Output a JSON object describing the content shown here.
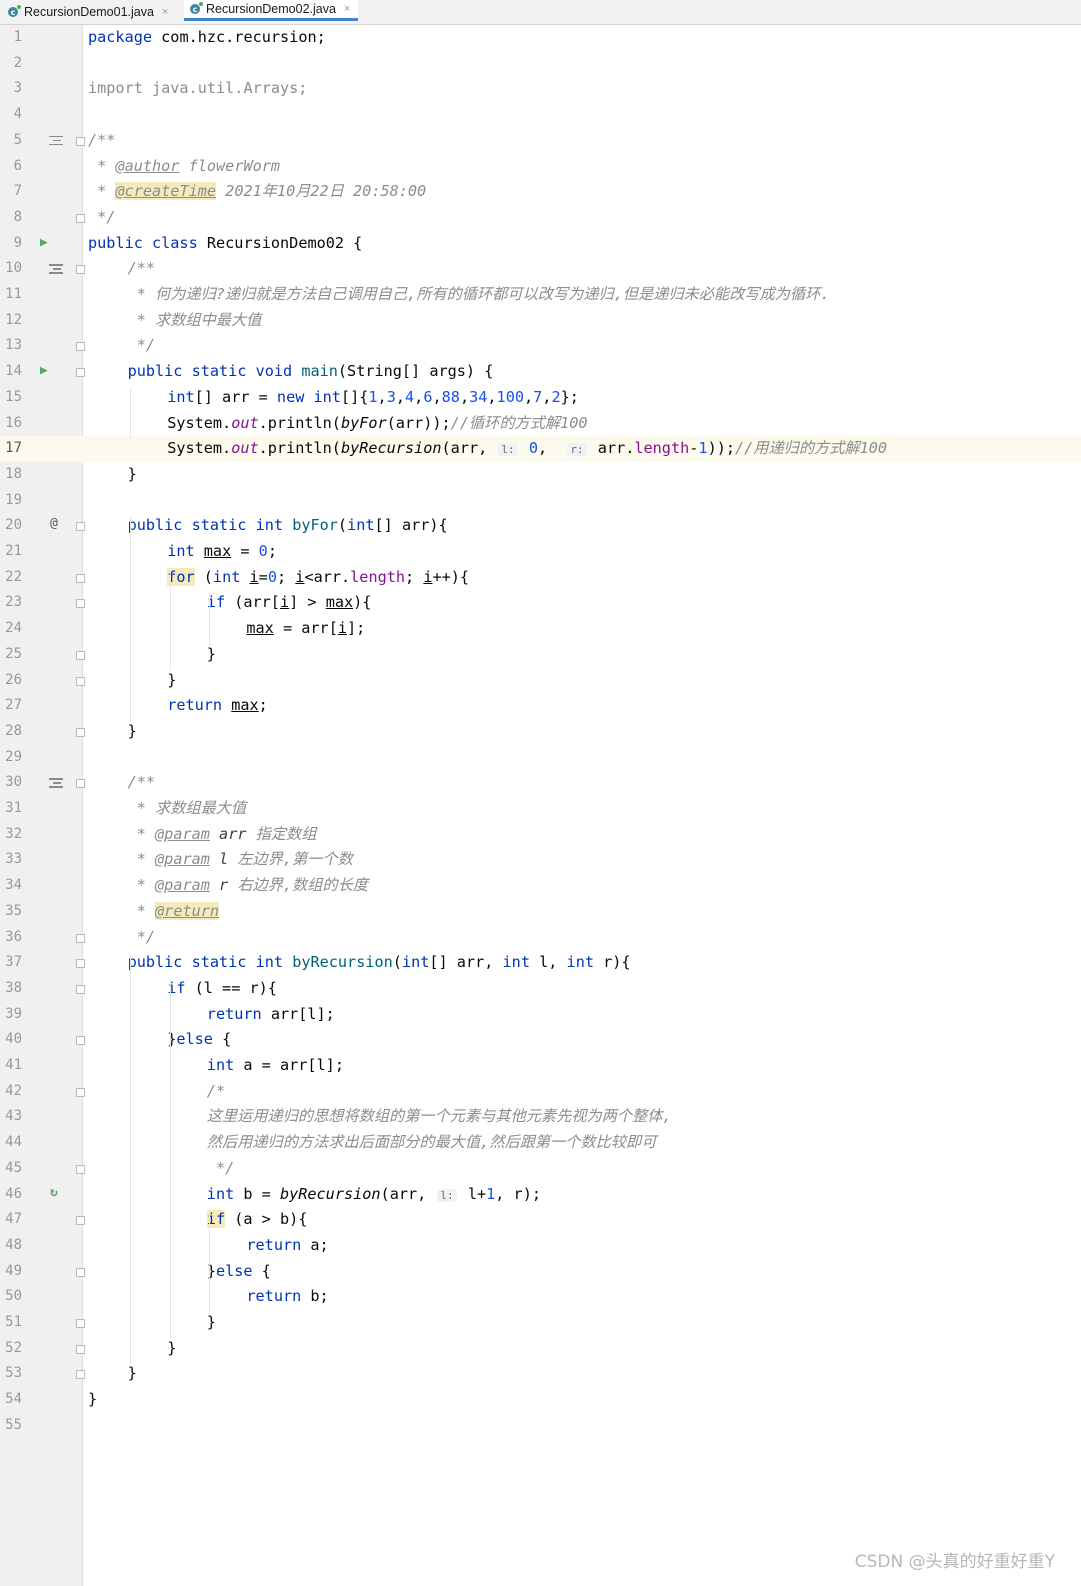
{
  "tabs": [
    {
      "label": "RecursionDemo01.java",
      "close": "×"
    },
    {
      "label": "RecursionDemo02.java",
      "close": "×",
      "active": true
    }
  ],
  "code": {
    "l1": {
      "a": "package",
      "b": " com.hzc.recursion;"
    },
    "l3": "import java.util.Arrays;",
    "l5": "/**",
    "l6": {
      "a": " * ",
      "b": "@author",
      "c": " flowerWorm"
    },
    "l7": {
      "a": " * ",
      "b": "@createTime",
      "c": " 2021年10月22日 20:58:00"
    },
    "l8": " */",
    "l9": {
      "a": "public class",
      "b": " RecursionDemo02 {"
    },
    "l10": "/**",
    "l11": " * 何为递归?递归就是方法自己调用自己,所有的循环都可以改写为递归,但是递归未必能改写成为循环.",
    "l12": " * 求数组中最大值",
    "l13": " */",
    "l14": {
      "a": "public static void",
      "b": " main",
      "c": "(String[] args) {"
    },
    "l15": {
      "a": "int",
      "b": "[] arr = ",
      "c": "new",
      "d": " ",
      "e": "int",
      "f": "[]{",
      "g": "1",
      "h": ",",
      "i": "3",
      "j": ",",
      "k": "4",
      "l": ",",
      "m": "6",
      "n": ",",
      "o": "88",
      "p": ",",
      "q": "34",
      "r": ",",
      "s": "100",
      "t": ",",
      "u": "7",
      "v": ",",
      "w": "2",
      "x": "};"
    },
    "l16": {
      "a": "System.",
      "b": "out",
      "c": ".println(",
      "d": "byFor",
      "e": "(arr));",
      "f": "//循环的方式解100"
    },
    "l17": {
      "a": "System.",
      "b": "out",
      "c": ".println(",
      "d": "byRecursion",
      "e": "(arr, ",
      "f": "l:",
      "g": " ",
      "h": "0",
      "i": ",  ",
      "j": "r:",
      "k": " arr.",
      "l": "length",
      "m": "-",
      "n": "1",
      "o": "));",
      "p": "//用递归的方式解100"
    },
    "l18": "}",
    "l20": {
      "a": "public static int",
      "b": " byFor",
      "c": "(",
      "d": "int",
      "e": "[] arr){"
    },
    "l21": {
      "a": "int",
      "b": " ",
      "c": "max",
      "d": " = ",
      "e": "0",
      "f": ";"
    },
    "l22": {
      "a": "for",
      "b": " (",
      "c": "int",
      "d": " ",
      "e": "i",
      "f": "=",
      "g": "0",
      "h": "; ",
      "i": "i",
      "j": "<arr.",
      "k": "length",
      "l": "; ",
      "m": "i",
      "n": "++){"
    },
    "l23": {
      "a": "if",
      "b": " (arr[",
      "c": "i",
      "d": "] > ",
      "e": "max",
      "f": "){"
    },
    "l24": {
      "a": "max",
      "b": " = arr[",
      "c": "i",
      "d": "];"
    },
    "l25": "}",
    "l26": "}",
    "l27": {
      "a": "return",
      "b": " ",
      "c": "max",
      "d": ";"
    },
    "l28": "}",
    "l30": "/**",
    "l31": " * 求数组最大值",
    "l32": {
      "a": " * ",
      "b": "@param",
      "c": " arr",
      "d": " 指定数组"
    },
    "l33": {
      "a": " * ",
      "b": "@param",
      "c": " l",
      "d": " 左边界,第一个数"
    },
    "l34": {
      "a": " * ",
      "b": "@param",
      "c": " r",
      "d": " 右边界,数组的长度"
    },
    "l35": {
      "a": " * ",
      "b": "@return"
    },
    "l36": " */",
    "l37": {
      "a": "public static int",
      "b": " byRecursion",
      "c": "(",
      "d": "int",
      "e": "[] arr, ",
      "f": "int",
      "g": " l, ",
      "h": "int",
      "i": " r){"
    },
    "l38": {
      "a": "if",
      "b": " (l == r){"
    },
    "l39": {
      "a": "return",
      "b": " arr[l];"
    },
    "l40": {
      "a": "}",
      "b": "else",
      "c": " {"
    },
    "l41": {
      "a": "int",
      "b": " a = arr[l];"
    },
    "l42": "/*",
    "l43": "这里运用递归的思想将数组的第一个元素与其他元素先视为两个整体,",
    "l44": "然后用递归的方法求出后面部分的最大值,然后跟第一个数比较即可",
    "l45": " */",
    "l46": {
      "a": "int",
      "b": " b = ",
      "c": "byRecursion",
      "d": "(arr, ",
      "e": "l:",
      "f": " l+",
      "g": "1",
      "h": ", r);"
    },
    "l47": {
      "a": "if",
      "b": " (a > b){"
    },
    "l48": {
      "a": "return",
      "b": " a;"
    },
    "l49": {
      "a": "}",
      "b": "else",
      "c": " {"
    },
    "l50": {
      "a": "return",
      "b": " b;"
    },
    "l51": "}",
    "l52": "}",
    "l53": "}",
    "l54": "}"
  },
  "line_numbers": [
    "1",
    "2",
    "3",
    "4",
    "5",
    "6",
    "7",
    "8",
    "9",
    "10",
    "11",
    "12",
    "13",
    "14",
    "15",
    "16",
    "17",
    "18",
    "19",
    "20",
    "21",
    "22",
    "23",
    "24",
    "25",
    "26",
    "27",
    "28",
    "29",
    "30",
    "31",
    "32",
    "33",
    "34",
    "35",
    "36",
    "37",
    "38",
    "39",
    "40",
    "41",
    "42",
    "43",
    "44",
    "45",
    "46",
    "47",
    "48",
    "49",
    "50",
    "51",
    "52",
    "53",
    "54",
    "55"
  ],
  "gutter": {
    "at": "@",
    "run": "▶",
    "recurse": "↻"
  },
  "watermark": "CSDN @头真的好重好重Y",
  "colors": {
    "keyword": "#0033b3",
    "number": "#1750eb",
    "comment": "#8c8c8c",
    "field": "#871094",
    "current_line": "#fcfaed",
    "tag_highlight": "#f5eabc"
  }
}
